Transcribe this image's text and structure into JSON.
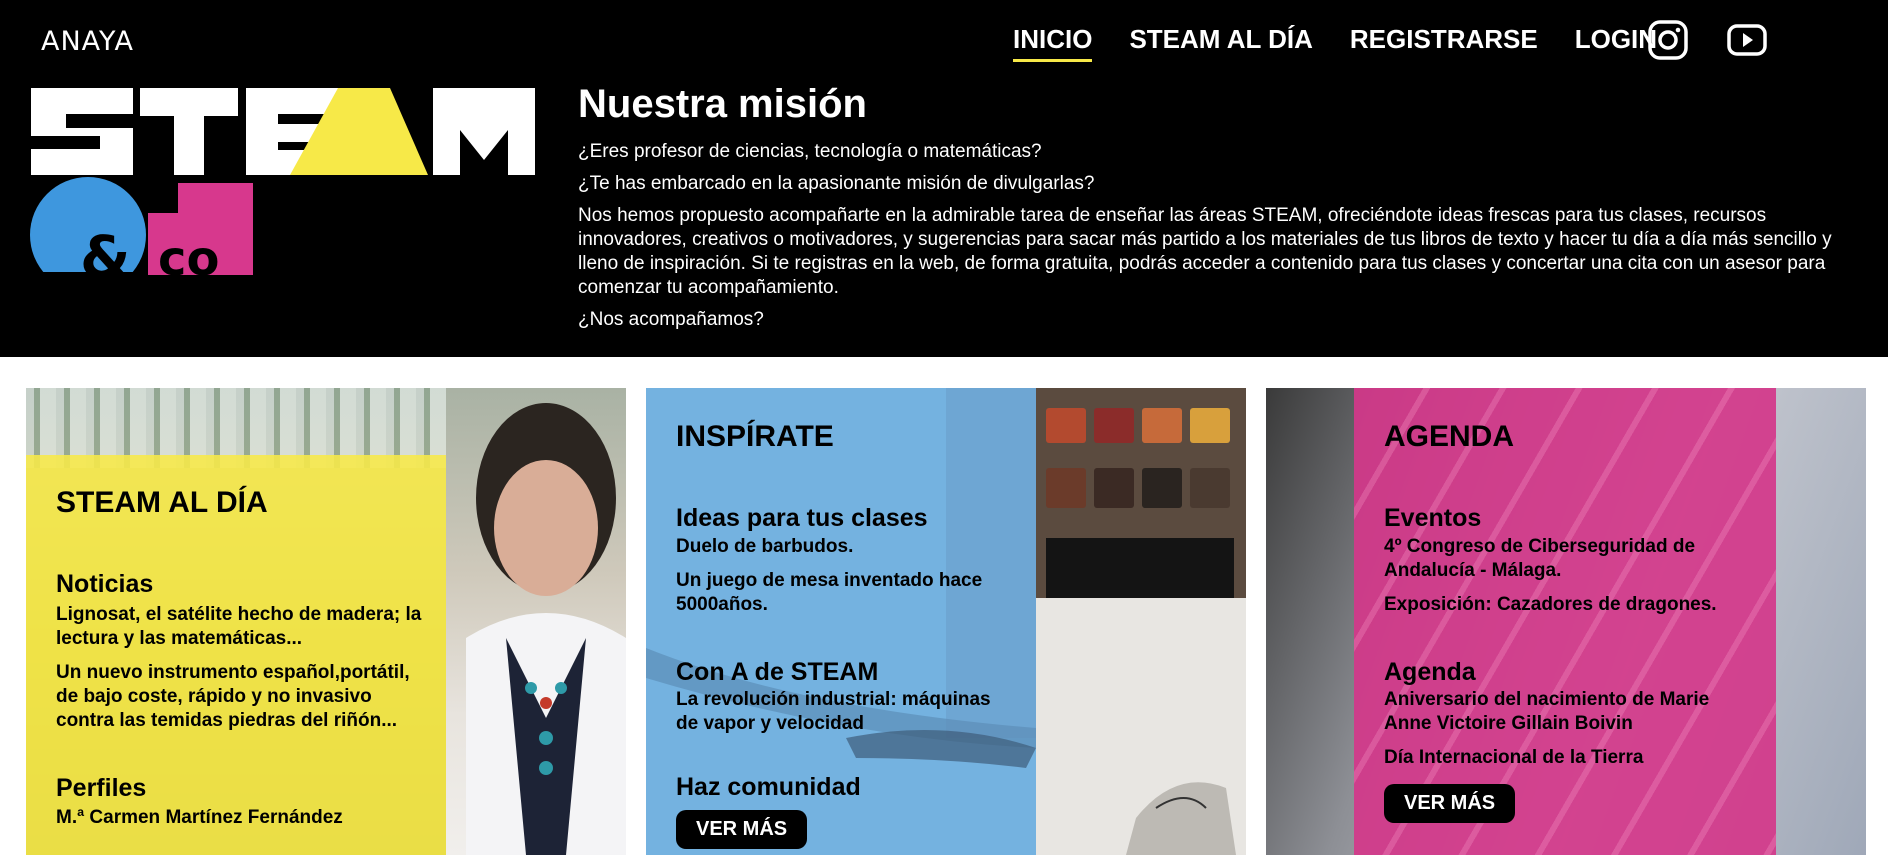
{
  "header": {
    "brand": "ANAYA",
    "nav": [
      {
        "label": "INICIO",
        "active": true
      },
      {
        "label": "STEAM AL DÍA",
        "active": false
      },
      {
        "label": "REGISTRARSE",
        "active": false
      },
      {
        "label": "LOGIN",
        "active": false
      }
    ],
    "social": [
      "instagram-icon",
      "youtube-icon"
    ],
    "logo": {
      "line1": "STEAM",
      "line2": "&co"
    },
    "colors": {
      "yellow": "#f7e948",
      "blue": "#3e97de",
      "magenta": "#d7388d",
      "background": "#000000"
    }
  },
  "mission": {
    "title": "Nuestra misión",
    "paragraphs": [
      "¿Eres profesor de ciencias, tecnología o matemáticas?",
      "¿Te has embarcado en la apasionante misión de divulgarlas?",
      "Nos hemos propuesto acompañarte en la admirable tarea de enseñar las áreas STEAM, ofreciéndote ideas frescas para tus clases, recursos innovadores, creativos o motivadores, y sugerencias para sacar más partido a los materiales de tus libros de texto y hacer tu día a día más sencillo y lleno de inspiración. Si te registras en la web, de forma gratuita, podrás acceder a contenido para tus clases y concertar una cita con un asesor para comenzar tu acompañamiento.",
      "¿Nos acompañamos?"
    ]
  },
  "cards": {
    "steam_al_dia": {
      "title": "STEAM AL DÍA",
      "sections": [
        {
          "heading": "Noticias",
          "items": [
            "Lignosat, el satélite hecho de madera; la lectura y las matemáticas...",
            "Un nuevo instrumento español,portátil, de bajo coste, rápido y no invasivo contra las temidas piedras del riñón..."
          ]
        },
        {
          "heading": "Perfiles",
          "items": [
            "M.ª Carmen Martínez Fernández"
          ]
        }
      ]
    },
    "inspirate": {
      "title": "INSPÍRATE",
      "sections": [
        {
          "heading": "Ideas para tus clases",
          "items": [
            "Duelo de barbudos.",
            "Un juego de mesa inventado hace 5000años."
          ]
        },
        {
          "heading": "Con A de STEAM",
          "items": [
            "La revolución industrial: máquinas de vapor y velocidad"
          ]
        },
        {
          "heading": "Haz comunidad",
          "items": []
        }
      ],
      "button": "VER MÁS"
    },
    "agenda": {
      "title": "AGENDA",
      "sections": [
        {
          "heading": "Eventos",
          "items": [
            "4º Congreso de Ciberseguridad de Andalucía - Málaga.",
            "Exposición: Cazadores de dragones."
          ]
        },
        {
          "heading": "Agenda",
          "items": [
            "Aniversario del nacimiento de Marie Anne Victoire Gillain Boivin",
            "Día Internacional de la Tierra"
          ]
        }
      ],
      "button": "VER MÁS"
    }
  }
}
